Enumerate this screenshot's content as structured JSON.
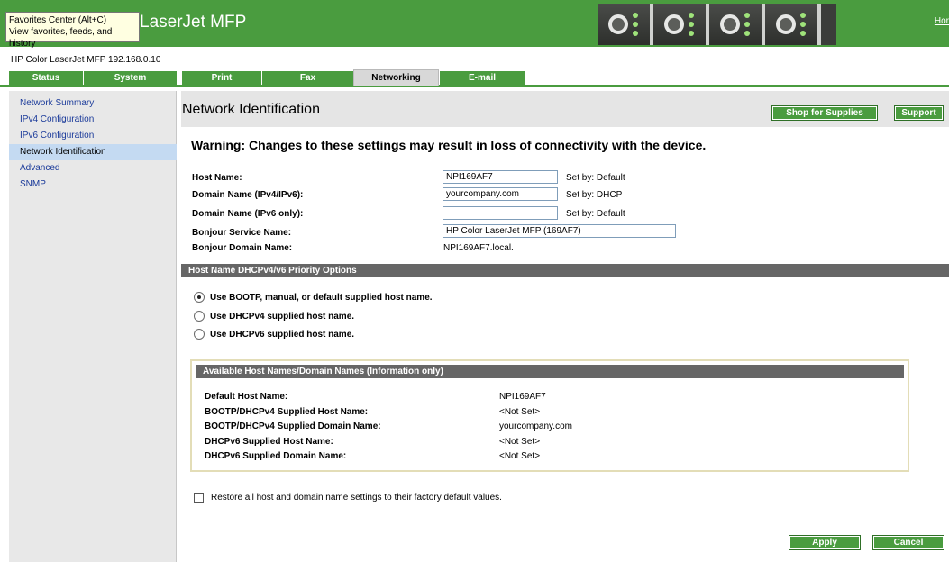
{
  "tooltip": {
    "line1": "Favorites Center (Alt+C)",
    "line2": "View favorites, feeds, and history"
  },
  "header": {
    "title": "LaserJet MFP",
    "home_link": "Hor"
  },
  "device_line": "HP Color LaserJet MFP   192.168.0.10",
  "tabs": [
    {
      "label": "Status"
    },
    {
      "label": "System"
    },
    {
      "label": "Print"
    },
    {
      "label": "Fax"
    },
    {
      "label": "Networking"
    },
    {
      "label": "E-mail"
    }
  ],
  "sidebar": {
    "items": [
      {
        "label": "Network Summary"
      },
      {
        "label": "IPv4 Configuration"
      },
      {
        "label": "IPv6 Configuration"
      },
      {
        "label": "Network Identification"
      },
      {
        "label": "Advanced"
      },
      {
        "label": "SNMP"
      }
    ]
  },
  "main": {
    "title": "Network Identification",
    "shop_button": "Shop for Supplies",
    "support_button": "Support",
    "warning": "Warning: Changes to these settings may result in loss of connectivity with the device.",
    "fields": {
      "host_name": {
        "label": "Host Name:",
        "value": "NPI169AF7",
        "set_by": "Set by:  Default"
      },
      "domain_v4v6": {
        "label": "Domain Name (IPv4/IPv6):",
        "value": "yourcompany.com",
        "set_by": "Set by:  DHCP"
      },
      "domain_v6": {
        "label": "Domain Name (IPv6 only):",
        "value": "",
        "set_by": "Set by:  Default"
      },
      "bonjour_service": {
        "label": "Bonjour Service Name:",
        "value": "HP Color LaserJet MFP (169AF7)"
      },
      "bonjour_domain": {
        "label": "Bonjour Domain Name:",
        "value": "NPI169AF7.local."
      }
    },
    "priority_header": "Host Name DHCPv4/v6 Priority Options",
    "radios": [
      {
        "label": "Use BOOTP, manual, or default supplied host name.",
        "checked": true
      },
      {
        "label": "Use DHCPv4 supplied host name.",
        "checked": false
      },
      {
        "label": "Use DHCPv6 supplied host name.",
        "checked": false
      }
    ],
    "info": {
      "header": "Available Host Names/Domain Names (Information only)",
      "rows": [
        {
          "label": "Default Host Name:",
          "value": "NPI169AF7"
        },
        {
          "label": "BOOTP/DHCPv4 Supplied Host Name:",
          "value": "<Not Set>"
        },
        {
          "label": "BOOTP/DHCPv4 Supplied Domain Name:",
          "value": "yourcompany.com"
        },
        {
          "label": "DHCPv6 Supplied Host Name:",
          "value": "<Not Set>"
        },
        {
          "label": "DHCPv6 Supplied Domain Name:",
          "value": "<Not Set>"
        }
      ]
    },
    "restore_label": "Restore all host and domain name settings to their factory default values.",
    "apply_button": "Apply",
    "cancel_button": "Cancel"
  },
  "colors": {
    "brand_green": "#4a9c3f",
    "section_gray": "#666666",
    "sidebar_active": "#c4daf2"
  }
}
